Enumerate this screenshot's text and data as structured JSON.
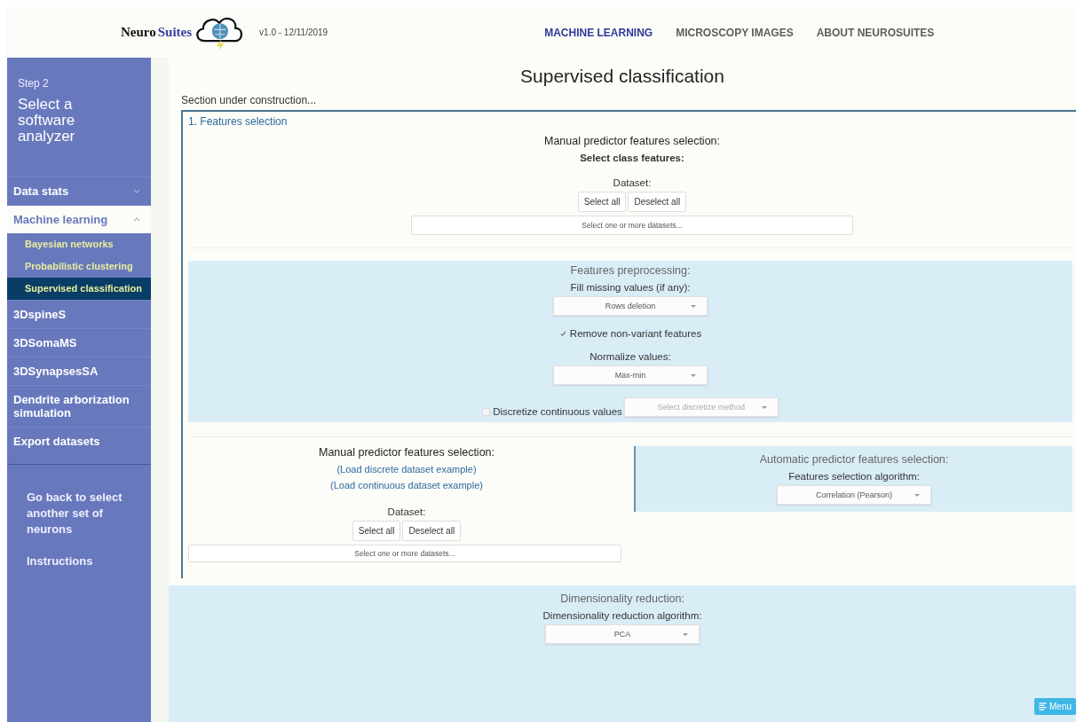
{
  "header": {
    "logo": {
      "part_1": "Neuro",
      "part_2": "Suites"
    },
    "version": "v1.0 - 12/11/2019",
    "nav": [
      {
        "label": "MACHINE LEARNING",
        "selected": true
      },
      {
        "label": "MICROSCOPY IMAGES",
        "selected": false
      },
      {
        "label": "ABOUT NEUROSUITES",
        "selected": false
      }
    ]
  },
  "sidebar": {
    "step": "Step 2",
    "title": "Select a software analyzer",
    "items": [
      {
        "label": "Data stats",
        "expanded": false
      },
      {
        "label": "Machine learning",
        "expanded": true,
        "children": [
          {
            "label": "Bayesian networks",
            "selected": false
          },
          {
            "label": "Probabilistic clustering",
            "selected": false
          },
          {
            "label": "Supervised classification",
            "selected": true
          }
        ]
      },
      {
        "label": "3DspineS"
      },
      {
        "label": "3DSomaMS"
      },
      {
        "label": "3DSynapsesSA"
      },
      {
        "label": "Dendrite arborization simulation"
      },
      {
        "label": "Export datasets"
      }
    ],
    "links": [
      "Go back to select another set of neurons",
      "Instructions"
    ]
  },
  "main": {
    "title": "Supervised classification",
    "notice": "Section under construction...",
    "section": {
      "title": "1. Features selection",
      "class_selection": {
        "heading": "Manual predictor features selection:",
        "subheading": "Select class features:",
        "dataset_label": "Dataset:",
        "buttons": [
          "Select all",
          "Deselect all"
        ],
        "placeholder": "Select one or more datasets..."
      },
      "preprocessing": {
        "heading": "Features preprocessing:",
        "fill_label": "Fill missing values (if any):",
        "fill_value": "Rows deletion",
        "remove_nonvariant": {
          "label": "Remove non-variant features",
          "checked": true
        },
        "normalize_label": "Normalize values:",
        "normalize_value": "Max-min",
        "discretize": {
          "label": "Discretize continuous values",
          "checked": false,
          "placeholder": "Select discretize method"
        }
      },
      "manual": {
        "heading": "Manual predictor features selection:",
        "links": [
          "(Load discrete dataset example)",
          "(Load continuous dataset example)"
        ],
        "dataset_label": "Dataset:",
        "buttons": [
          "Select all",
          "Deselect all"
        ],
        "placeholder": "Select one or more datasets..."
      },
      "automatic": {
        "heading": "Automatic predictor features selection:",
        "algorithm_label": "Features selection algorithm:",
        "algorithm_value": "Correlation (Pearson)"
      }
    },
    "dimensionality": {
      "heading": "Dimensionality reduction:",
      "algorithm_label": "Dimensionality reduction algorithm:",
      "algorithm_value": "PCA"
    },
    "menu_button": "Menu"
  }
}
